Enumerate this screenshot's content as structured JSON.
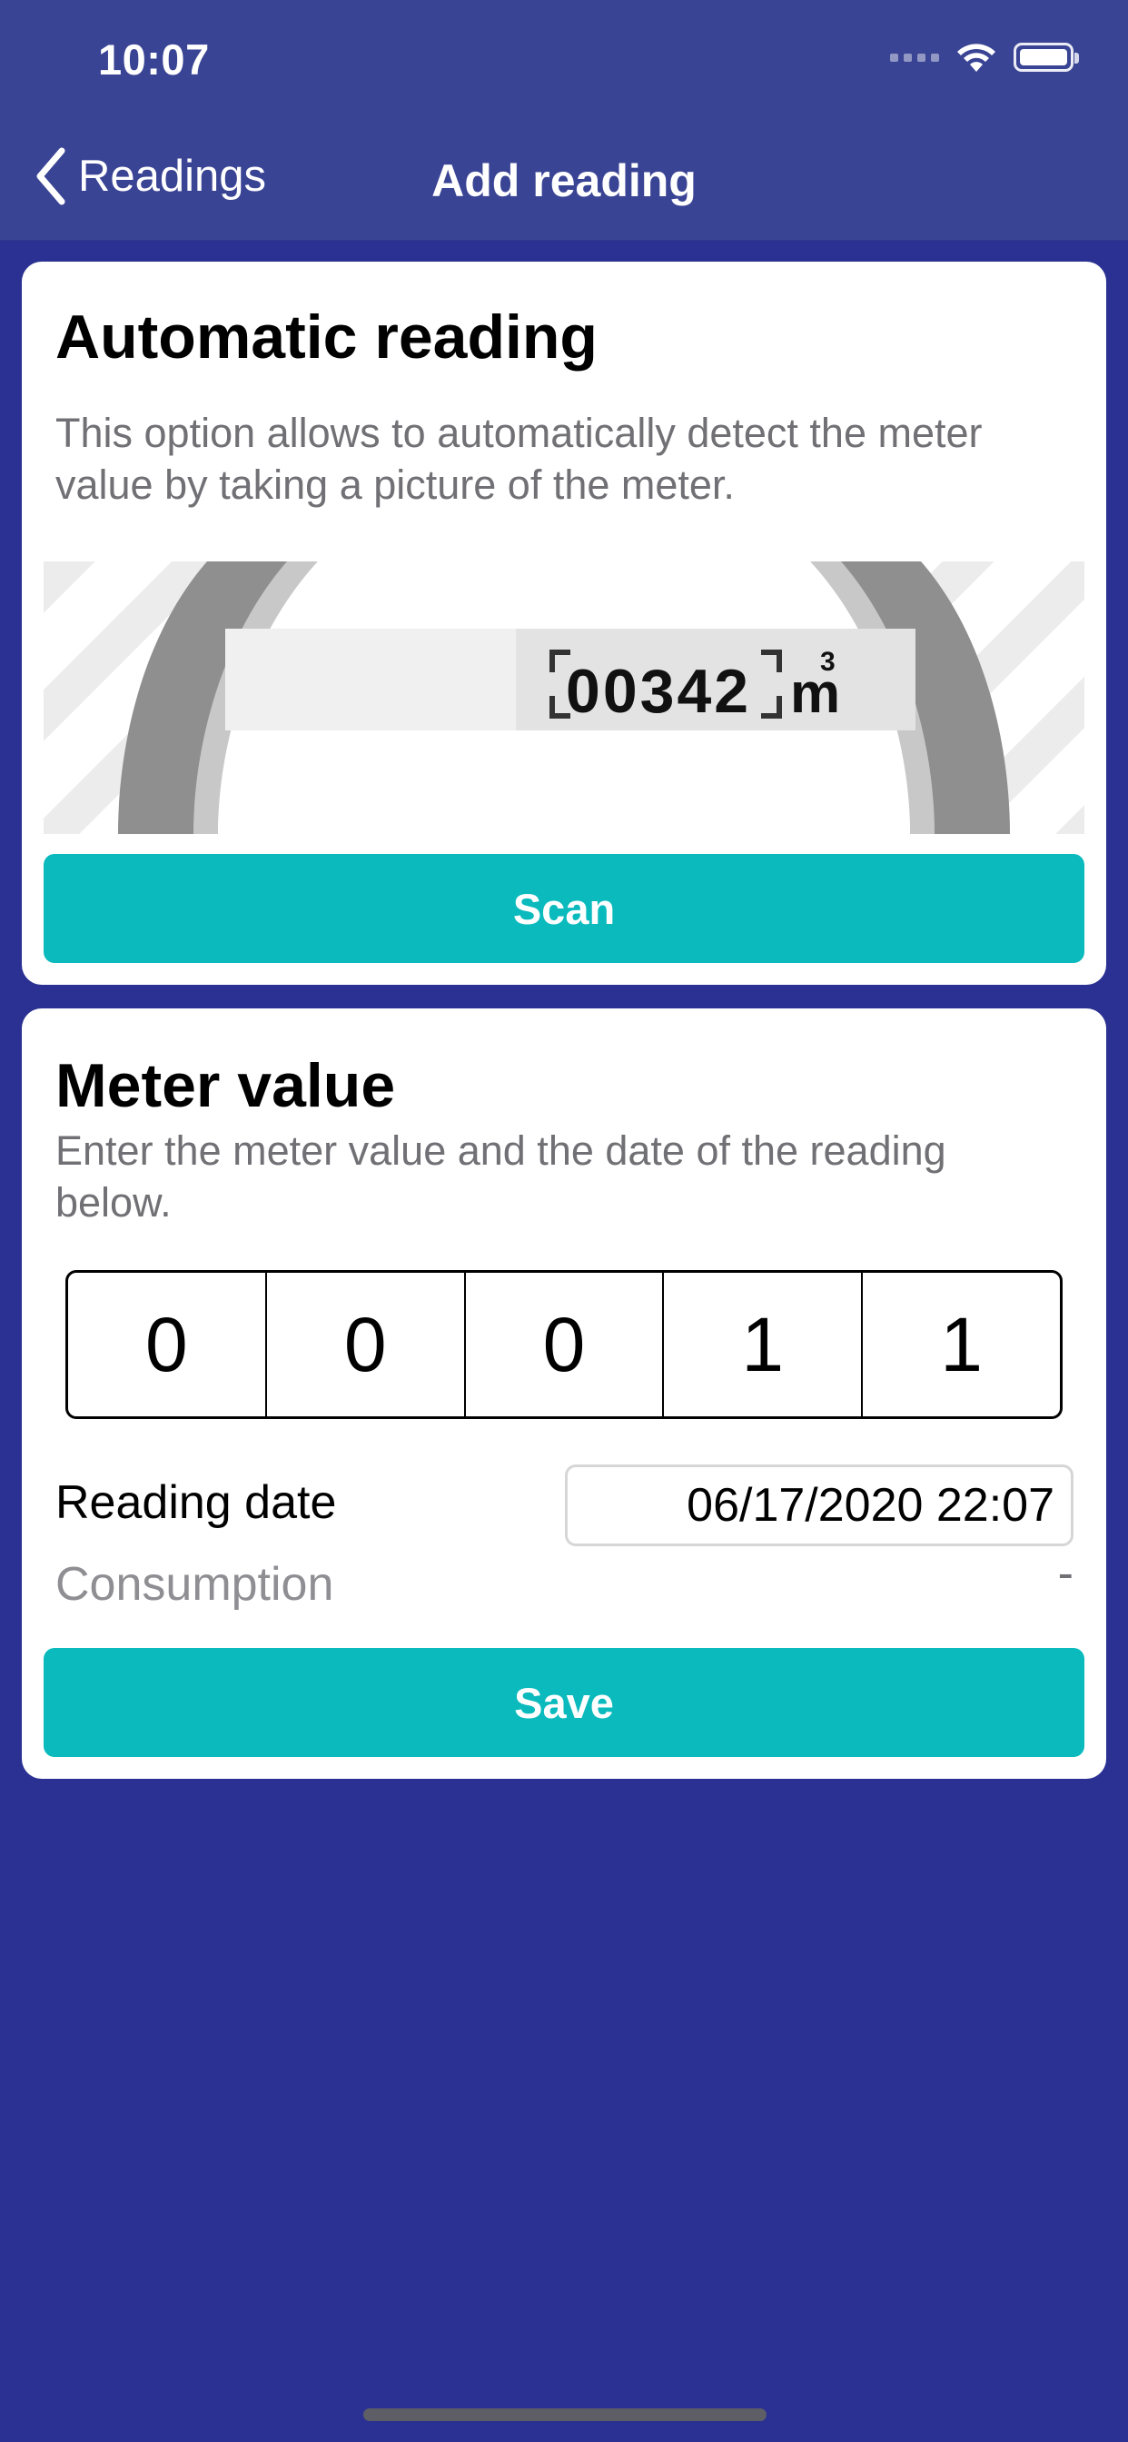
{
  "status_bar": {
    "time": "10:07"
  },
  "nav": {
    "back_label": "Readings",
    "title": "Add reading"
  },
  "automatic_reading": {
    "title": "Automatic reading",
    "description": "This option allows to automatically detect the meter value by taking a picture of the meter.",
    "meter_display": {
      "value": "00342",
      "unit": "m",
      "unit_exponent": "3"
    },
    "scan_label": "Scan"
  },
  "meter_value": {
    "title": "Meter value",
    "description": "Enter the meter value and the date of the reading below.",
    "digits": [
      "0",
      "0",
      "0",
      "1",
      "1"
    ],
    "reading_date_label": "Reading date",
    "reading_date_value": "06/17/2020 22:07",
    "consumption_label": "Consumption",
    "consumption_value": "-",
    "save_label": "Save"
  },
  "colors": {
    "background": "#2a3192",
    "header": "#3a4494",
    "accent": "#0ababd",
    "muted_text": "#707075"
  }
}
